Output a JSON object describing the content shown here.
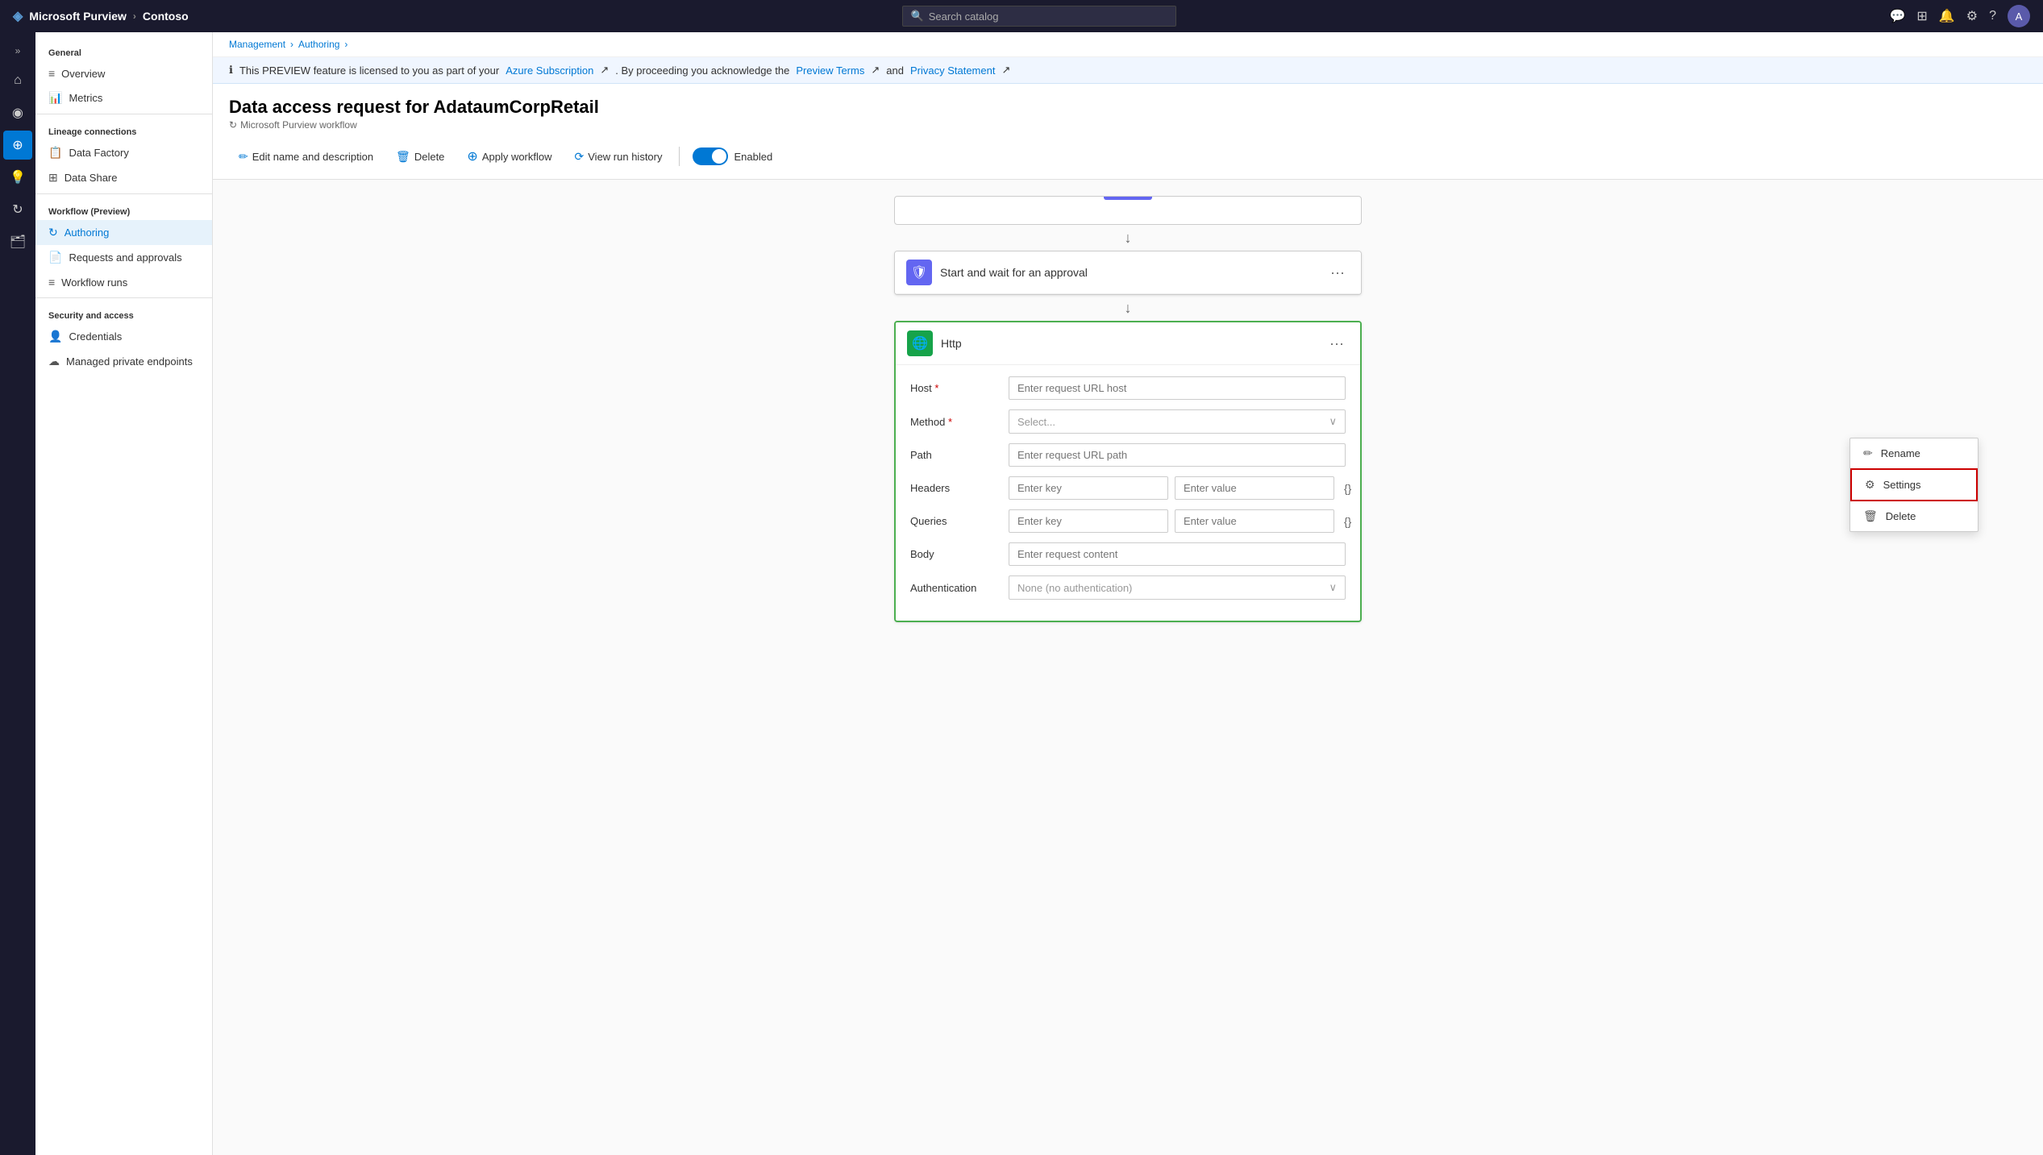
{
  "topbar": {
    "brand": "Microsoft Purview",
    "chevron": "›",
    "tenant": "Contoso",
    "search_placeholder": "Search catalog",
    "search_icon": "🔍",
    "icons": [
      "💬",
      "⊞",
      "🔔",
      "⚙",
      "?"
    ],
    "avatar_initial": "A"
  },
  "sidebar_icons": [
    {
      "name": "expand-icon",
      "icon": "»"
    },
    {
      "name": "home-icon",
      "icon": "⌂"
    },
    {
      "name": "scan-icon",
      "icon": "◎"
    },
    {
      "name": "catalog-icon",
      "icon": "⊕"
    },
    {
      "name": "insights-icon",
      "icon": "💡"
    },
    {
      "name": "workflow-icon",
      "icon": "◔"
    },
    {
      "name": "briefcase-icon",
      "icon": "🗂"
    }
  ],
  "sidebar": {
    "sections": [
      {
        "label": "General",
        "items": [
          {
            "label": "Overview",
            "icon": "≡",
            "active": false
          },
          {
            "label": "Metrics",
            "icon": "📊",
            "active": false
          }
        ]
      },
      {
        "label": "Lineage connections",
        "items": [
          {
            "label": "Data Factory",
            "icon": "📋",
            "active": false
          },
          {
            "label": "Data Share",
            "icon": "⊞",
            "active": false
          }
        ]
      },
      {
        "label": "Workflow (Preview)",
        "items": [
          {
            "label": "Authoring",
            "icon": "↻",
            "active": false
          },
          {
            "label": "Requests and approvals",
            "icon": "📄",
            "active": false
          },
          {
            "label": "Workflow runs",
            "icon": "≡",
            "active": false
          }
        ]
      },
      {
        "label": "Security and access",
        "items": [
          {
            "label": "Credentials",
            "icon": "👤",
            "active": false
          },
          {
            "label": "Managed private endpoints",
            "icon": "☁",
            "active": false
          }
        ]
      }
    ]
  },
  "breadcrumb": {
    "items": [
      "Management",
      "Authoring"
    ],
    "separator": "›"
  },
  "banner": {
    "icon": "ℹ",
    "text_before": "This PREVIEW feature is licensed to you as part of your",
    "link1": "Azure Subscription",
    "text_middle": ". By proceeding you acknowledge the",
    "link2": "Preview Terms",
    "text_and": "and",
    "link3": "Privacy Statement"
  },
  "page": {
    "title": "Data access request for AdataumCorpRetail",
    "subtitle": "Microsoft Purview workflow",
    "subtitle_icon": "↻"
  },
  "toolbar": {
    "edit_label": "Edit name and description",
    "edit_icon": "✏",
    "delete_label": "Delete",
    "delete_icon": "🗑",
    "apply_label": "Apply workflow",
    "apply_icon": "+",
    "history_label": "View run history",
    "history_icon": "⟳",
    "toggle_label": "Enabled",
    "toggle_on": true
  },
  "workflow": {
    "blocks": [
      {
        "id": "approval",
        "title": "Start and wait for an approval",
        "icon_type": "approval",
        "icon": "🛡"
      },
      {
        "id": "http",
        "title": "Http",
        "icon_type": "http",
        "icon": "🌐",
        "fields": [
          {
            "label": "Host",
            "required": true,
            "type": "input",
            "placeholder": "Enter request URL host"
          },
          {
            "label": "Method",
            "required": true,
            "type": "select",
            "placeholder": "Select..."
          },
          {
            "label": "Path",
            "required": false,
            "type": "input",
            "placeholder": "Enter request URL path"
          },
          {
            "label": "Headers",
            "required": false,
            "type": "pair",
            "placeholder_key": "Enter key",
            "placeholder_value": "Enter value"
          },
          {
            "label": "Queries",
            "required": false,
            "type": "pair",
            "placeholder_key": "Enter key",
            "placeholder_value": "Enter value"
          },
          {
            "label": "Body",
            "required": false,
            "type": "input",
            "placeholder": "Enter request content"
          },
          {
            "label": "Authentication",
            "required": false,
            "type": "select",
            "placeholder": "None (no authentication)"
          }
        ]
      }
    ]
  },
  "context_menu": {
    "items": [
      {
        "label": "Rename",
        "icon": "✏"
      },
      {
        "label": "Settings",
        "icon": "⚙",
        "highlighted": true
      },
      {
        "label": "Delete",
        "icon": "🗑"
      }
    ]
  }
}
